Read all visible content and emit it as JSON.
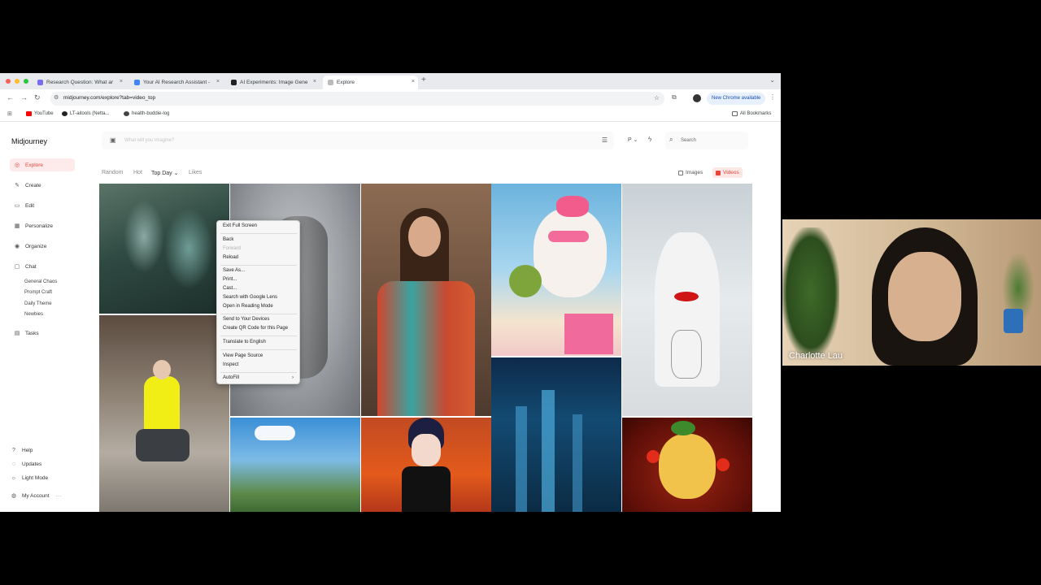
{
  "browser": {
    "tabs": [
      {
        "title": "Research Question: What ar"
      },
      {
        "title": "Your AI Research Assistant -"
      },
      {
        "title": "AI Experiments: Image Gene"
      },
      {
        "title": "Explore"
      }
    ],
    "url": "midjourney.com/explore?tab=video_top",
    "new_chrome_label": "New Chrome available",
    "bookmarks": [
      {
        "label": "YouTube"
      },
      {
        "label": "LT-aitools (Netta..."
      },
      {
        "label": "health-buddie-log"
      }
    ],
    "all_bookmarks_label": "All Bookmarks"
  },
  "app": {
    "logo": "Midjourney",
    "nav": [
      {
        "label": "Explore"
      },
      {
        "label": "Create"
      },
      {
        "label": "Edit"
      },
      {
        "label": "Personalize"
      },
      {
        "label": "Organize"
      },
      {
        "label": "Chat"
      }
    ],
    "chat_channels": [
      "General Chaos",
      "Prompt Craft",
      "Daily Theme",
      "Newbies"
    ],
    "tasks_label": "Tasks",
    "bottom_nav": [
      {
        "label": "Help"
      },
      {
        "label": "Updates"
      },
      {
        "label": "Light Mode"
      },
      {
        "label": "My Account"
      }
    ],
    "imagine_placeholder": "What will you imagine?",
    "search_placeholder": "Search",
    "p_label": "P",
    "filters": [
      "Random",
      "Hot",
      "Top Day",
      "Likes"
    ],
    "media_tabs": [
      {
        "label": "Images"
      },
      {
        "label": "Videos"
      }
    ]
  },
  "context_menu": {
    "items": [
      {
        "label": "Exit Full Screen"
      },
      {
        "label": "Back"
      },
      {
        "label": "Forward"
      },
      {
        "label": "Reload"
      },
      {
        "label": "Save As..."
      },
      {
        "label": "Print..."
      },
      {
        "label": "Cast..."
      },
      {
        "label": "Search with Google Lens"
      },
      {
        "label": "Open in Reading Mode"
      },
      {
        "label": "Send to Your Devices"
      },
      {
        "label": "Create QR Code for this Page"
      },
      {
        "label": "Translate to English"
      },
      {
        "label": "View Page Source"
      },
      {
        "label": "Inspect"
      },
      {
        "label": "AutoFill"
      }
    ]
  },
  "webcam": {
    "participant_name": "Charlotte Lau"
  },
  "colors": {
    "accent": "#e8453c",
    "accent_bg": "#fdeaea"
  }
}
